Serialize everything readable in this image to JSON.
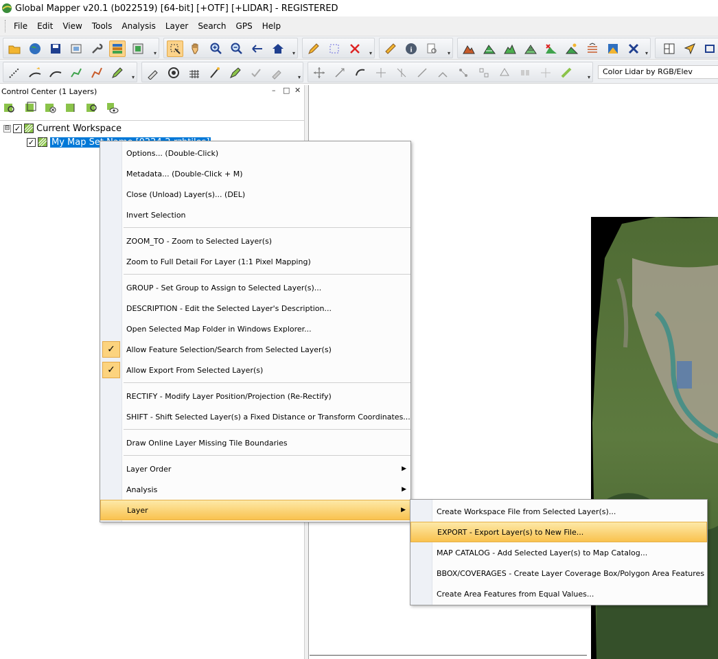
{
  "window": {
    "title": "Global Mapper v20.1 (b022519) [64-bit] [+OTF] [+LIDAR] - REGISTERED"
  },
  "menubar": {
    "items": [
      "File",
      "Edit",
      "View",
      "Tools",
      "Analysis",
      "Layer",
      "Search",
      "GPS",
      "Help"
    ]
  },
  "toolbar": {
    "combo_value": "Color Lidar by RGB/Elev"
  },
  "control_center": {
    "title": "Control Center (1 Layers)",
    "minimize": "–",
    "restore": "□",
    "close": "✕",
    "tree": {
      "root": {
        "label": "Current Workspace",
        "expander": "⊟",
        "check": "✓"
      },
      "layer": {
        "label": "My Map Set Name [0224-2.rzhtiles]",
        "check": "✓"
      }
    }
  },
  "context_menu": {
    "items": [
      {
        "label": "Options... (Double-Click)"
      },
      {
        "label": "Metadata... (Double-Click + M)"
      },
      {
        "label": "Close (Unload) Layer(s)... (DEL)"
      },
      {
        "label": "Invert Selection"
      },
      {
        "label": "ZOOM_TO - Zoom to Selected Layer(s)"
      },
      {
        "label": "Zoom to Full Detail For Layer (1:1 Pixel Mapping)"
      },
      {
        "label": "GROUP - Set Group to Assign to Selected Layer(s)..."
      },
      {
        "label": "DESCRIPTION - Edit the Selected Layer's Description..."
      },
      {
        "label": "Open Selected Map Folder in Windows Explorer..."
      },
      {
        "label": "Allow Feature Selection/Search from Selected Layer(s)",
        "checked": true
      },
      {
        "label": "Allow Export From Selected Layer(s)",
        "checked": true
      },
      {
        "label": "RECTIFY - Modify Layer Position/Projection (Re-Rectify)"
      },
      {
        "label": "SHIFT - Shift Selected Layer(s) a Fixed Distance or Transform Coordinates..."
      },
      {
        "label": "Draw Online Layer Missing Tile Boundaries"
      },
      {
        "label": "Layer Order",
        "submenu": true
      },
      {
        "label": "Analysis",
        "submenu": true
      },
      {
        "label": "Layer",
        "submenu": true,
        "highlighted": true
      }
    ],
    "check_glyph": "✓",
    "submenu_glyph": "▶"
  },
  "submenu": {
    "items": [
      {
        "label": "Create Workspace File from Selected Layer(s)..."
      },
      {
        "label": "EXPORT - Export Layer(s) to New File...",
        "highlighted": true
      },
      {
        "label": "MAP CATALOG - Add Selected Layer(s) to Map Catalog..."
      },
      {
        "label": "BBOX/COVERAGES  - Create Layer Coverage Box/Polygon Area Features"
      },
      {
        "label": "Create Area Features from Equal Values..."
      }
    ]
  },
  "colors": {
    "highlight": "#f9c24e",
    "selection": "#0078d7",
    "check_bg": "#fcd37e"
  }
}
